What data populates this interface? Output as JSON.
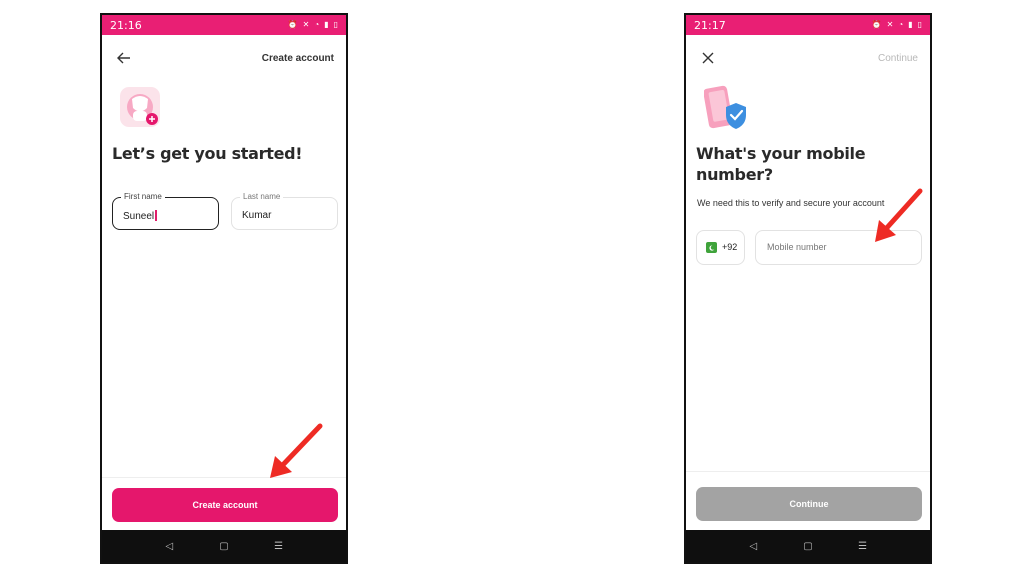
{
  "colors": {
    "accent": "#e5176c",
    "status_bar": "#e91f74",
    "disabled_button": "#a3a3a3",
    "arrow": "#ee2b24",
    "nav_bar": "#0f0f0f"
  },
  "screen1": {
    "status": {
      "time": "21:16"
    },
    "header": {
      "back_icon": "arrow-left-icon",
      "action_label": "Create account"
    },
    "hero_icon": "user-add-icon",
    "heading": "Let’s get you started!",
    "first_name": {
      "label": "First name",
      "value": "Suneel"
    },
    "last_name": {
      "label": "Last name",
      "value": "Kumar"
    },
    "button_label": "Create account"
  },
  "screen2": {
    "status": {
      "time": "21:17"
    },
    "header": {
      "close_icon": "close-icon",
      "action_label": "Continue"
    },
    "hero_icon": "phone-shield-icon",
    "heading_line1": "What's your mobile",
    "heading_line2": "number?",
    "subtext": "We need this to verify and secure your account",
    "country_code": {
      "flag_icon": "pakistan-flag-icon",
      "value": "+92"
    },
    "mobile_number": {
      "placeholder": "Mobile number"
    },
    "button_label": "Continue"
  },
  "navbar": {
    "back": "◁",
    "home": "▢",
    "recents": "☰"
  }
}
